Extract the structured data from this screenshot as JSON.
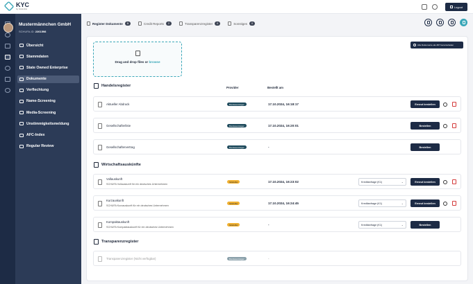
{
  "header": {
    "logo_text": "KYC",
    "logo_sub": "by SCHUFA",
    "logout_label": "Logout"
  },
  "sidebar": {
    "company": "Mustermännchen GmbH",
    "schufa_label": "SCHUFA-ID:",
    "schufa_id": "2261598",
    "items": [
      {
        "label": "Übersicht"
      },
      {
        "label": "Stammdaten"
      },
      {
        "label": "State Owned Enterprise"
      },
      {
        "label": "Dokumente"
      },
      {
        "label": "Verflechtung"
      },
      {
        "label": "Name-Screening"
      },
      {
        "label": "Media-Screening"
      },
      {
        "label": "Unstimmigkeitsmeldung"
      },
      {
        "label": "AFC-Index"
      },
      {
        "label": "Regular Review"
      }
    ]
  },
  "tabs": [
    {
      "label": "Register Dokumente",
      "count": "3"
    },
    {
      "label": "Credit Reports",
      "count": "2"
    },
    {
      "label": "Transparenzregister",
      "count": "0"
    },
    {
      "label": "Sonstiges",
      "count": "0"
    }
  ],
  "upload": {
    "text": "Drag and drop files or ",
    "link": "browse"
  },
  "download_all_label": "Alle Dokumente als ZIP herunterladen",
  "handelsregister": {
    "title": "Handelsregister",
    "col_provider": "Provider",
    "col_ordered": "Bestellt am",
    "rows": [
      {
        "name": "Aktueller Abdruck",
        "provider": "Bundesanzeiger",
        "date": "17.10.2024, 16:18:17",
        "button": "Erneut bestellen"
      },
      {
        "name": "Gesellschafterliste",
        "provider": "Bundesanzeiger",
        "date": "17.10.2024, 16:20:01",
        "button": "Bestellen"
      },
      {
        "name": "Gesellschaftervertrag",
        "provider": "Bundesanzeiger",
        "date": "-",
        "button": "Bestellen"
      }
    ]
  },
  "wirtschaft": {
    "title": "Wirtschaftsauskünfte",
    "rows": [
      {
        "name": "Vollauskunft",
        "desc": "SCHUFA Vollauskunft für ein deutsches Unternehmen",
        "provider": "SCHUFA",
        "date": "17.10.2024, 16:23:02",
        "select": "Kreditanfrage (K1)",
        "button": "Erneut bestellen"
      },
      {
        "name": "Kurzauskunft",
        "desc": "SCHUFA Kurzauskunft für ein deutsches Unternehmen",
        "provider": "SCHUFA",
        "date": "17.10.2024, 16:24:45",
        "select": "Kreditanfrage (K1)",
        "button": "Erneut bestellen"
      },
      {
        "name": "Kompaktauskunft",
        "desc": "SCHUFA Kompaktauskunft für ein deutsches Unternehmen",
        "provider": "SCHUFA",
        "date": "-",
        "select": "Kreditanfrage (K1)",
        "button": "Bestellen"
      }
    ]
  },
  "transparenz": {
    "title": "Transparenzregister",
    "rows": [
      {
        "name": "Transparenzregister (Nicht verfügbar)",
        "provider": "Bundesanzeiger",
        "date": "-"
      }
    ]
  },
  "colors": {
    "navy": "#1d2b45",
    "teal": "#3aa7b8",
    "sidebar": "#2c3b57",
    "schufa_yellow": "#f0b030",
    "danger": "#d43a3a"
  }
}
